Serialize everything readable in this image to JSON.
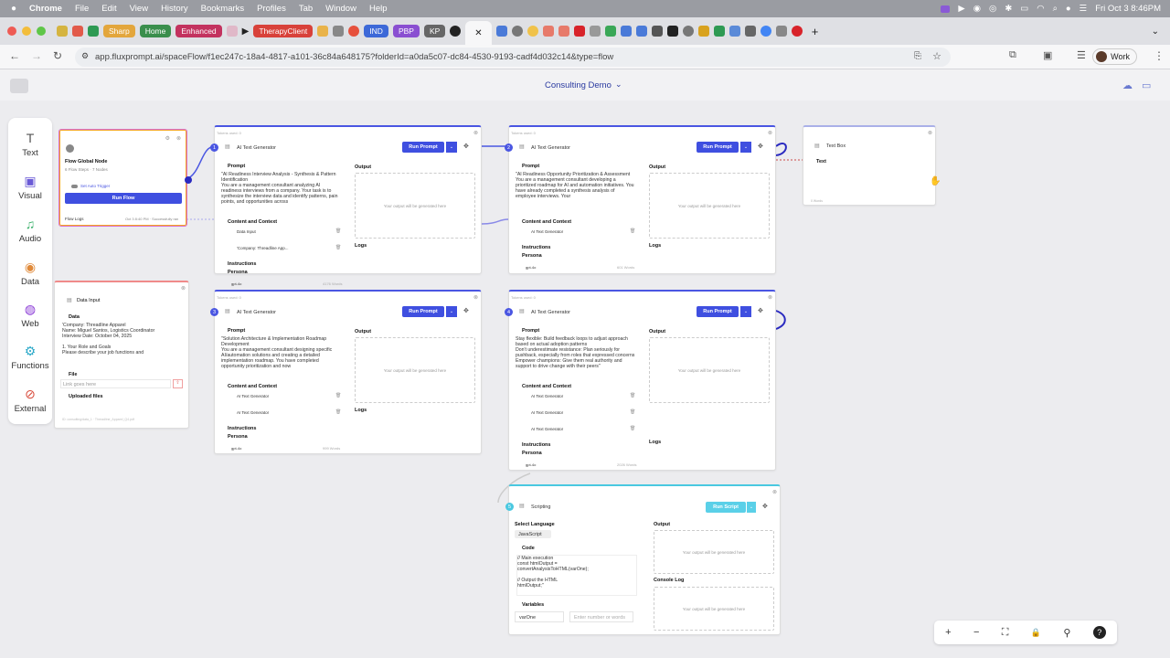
{
  "menubar": {
    "app": "Chrome",
    "items": [
      "File",
      "Edit",
      "View",
      "History",
      "Bookmarks",
      "Profiles",
      "Tab",
      "Window",
      "Help"
    ],
    "datetime": "Fri Oct 3  8:46PM"
  },
  "tabs": {
    "sharp": "Sharp",
    "home": "Home",
    "enhanced": "Enhanced",
    "therapy": "TherapyClient",
    "ind": "IND",
    "pbp": "PBP",
    "kp": "KP"
  },
  "address": {
    "url": "app.fluxprompt.ai/spaceFlow/f1ec247c-18a4-4817-a101-36c84a648175?folderId=a0da5c07-dc84-4530-9193-cadf4d032c14&type=flow",
    "profile": "Work"
  },
  "app": {
    "title": "Consulting Demo"
  },
  "sidebar": {
    "items": [
      {
        "label": "Text",
        "glyph": "T"
      },
      {
        "label": "Visual",
        "glyph": "▣"
      },
      {
        "label": "Audio",
        "glyph": "♫"
      },
      {
        "label": "Data",
        "glyph": "◉"
      },
      {
        "label": "Web",
        "glyph": "◍"
      },
      {
        "label": "Functions",
        "glyph": "⚙"
      },
      {
        "label": "External",
        "glyph": "⊘"
      }
    ]
  },
  "global": {
    "title": "Flow Global Node",
    "sub": "6 Flow Steps · 7 Nodes",
    "trigger": "Set Auto Trigger",
    "run": "Run Flow",
    "logs": "Flow Logs",
    "status": "Oct 3 8:40 PM · Successfully ran"
  },
  "datainput": {
    "title": "Data Input",
    "data_label": "Data",
    "data_text": "'Company: Threadline Apparel\n Name: Miguel Santos, Logistics Coordinator\nInterview Date: October 04, 2025\n\n1. Your Role and Goals\nPlease describe your job functions and",
    "file_label": "File",
    "file_placeholder": "Link goes here",
    "uploaded": "Uploaded files",
    "footer": "ID: consulting/data_1 · Threadline_Apparel_Q4.pdf"
  },
  "nodes": [
    {
      "num": "1",
      "tokens": "Tokens used: 0",
      "title": "AI Text Generator",
      "run": "Run Prompt",
      "prompt_label": "Prompt",
      "prompt": "\"AI Readiness Interview Analysis - Synthesis & Pattern Identification\nYou are a management consultant analyzing AI readiness interviews from a company. Your task is to synthesize the interview data and identify patterns, pain points, and opportunities across",
      "context": "Content and Context",
      "data_items": [
        "Data Input",
        "'Company: Threadline App..."
      ],
      "instructions": "Instructions",
      "persona": "Persona",
      "model": "gpt-4o",
      "words": "4176 Words",
      "output": "Output",
      "placeholder": "Your output will be generated here",
      "logs": "Logs"
    },
    {
      "num": "2",
      "tokens": "Tokens used: 0",
      "title": "AI Text Generator",
      "run": "Run Prompt",
      "prompt_label": "Prompt",
      "prompt": "\"AI Readiness Opportunity Prioritization & Assessment\nYou are a management consultant developing a prioritized roadmap for AI and automation initiatives. You have already completed a synthesis analysis of employee interviews. Your",
      "context": "Content and Context",
      "data_items": [
        "AI Text Generator"
      ],
      "instructions": "Instructions",
      "persona": "Persona",
      "model": "gpt-4o",
      "words": "601 Words",
      "output": "Output",
      "placeholder": "Your output will be generated here",
      "logs": "Logs"
    },
    {
      "num": "3",
      "tokens": "Tokens used: 0",
      "title": "AI Text Generator",
      "run": "Run Prompt",
      "prompt_label": "Prompt",
      "prompt": "\"Solution Architecture & Implementation Roadmap Development\nYou are a management consultant designing specific AI/automation solutions and creating a detailed implementation roadmap. You have completed opportunity prioritization and now",
      "context": "Content and Context",
      "data_items": [
        "AI Text Generator",
        "AI Text Generator"
      ],
      "instructions": "Instructions",
      "persona": "Persona",
      "model": "gpt-4o",
      "words": "999 Words",
      "output": "Output",
      "placeholder": "Your output will be generated here",
      "logs": "Logs"
    },
    {
      "num": "4",
      "tokens": "Tokens used: 0",
      "title": "AI Text Generator",
      "run": "Run Prompt",
      "prompt_label": "Prompt",
      "prompt": "Stay flexible: Build feedback loops to adjust approach based on actual adoption patterns\nDon't underestimate resistance: Plan seriously for pushback, especially from roles that expressed concerns\nEmpower champions: Give them real authority and support to drive change with their peers\"",
      "context": "Content and Context",
      "data_items": [
        "AI Text Generator",
        "AI Text Generator",
        "AI Text Generator"
      ],
      "instructions": "Instructions",
      "persona": "Persona",
      "model": "gpt-4o",
      "words": "2026 Words",
      "output": "Output",
      "placeholder": "Your output will be generated here",
      "logs": "Logs"
    }
  ],
  "textbox": {
    "title": "Text Box",
    "text": "Text",
    "words": "0 Words"
  },
  "scripting": {
    "num": "5",
    "title": "Scripting",
    "run": "Run Script",
    "lang_label": "Select Language",
    "lang": "JavaScript",
    "code_label": "Code",
    "code": "// Main execution\nconst htmlOutput =\nconvertAnalysisToHTML(varOne);\n\n// Output the HTML\nhtmlOutput;\"",
    "vars_label": "Variables",
    "var_name": "varOne",
    "var_placeholder": "Enter number or words",
    "output": "Output",
    "placeholder": "Your output will be generated here",
    "console": "Console Log"
  },
  "toolbar": {
    "zoom_in": "+",
    "zoom_out": "−",
    "fit": "⛶",
    "lock": "🔒",
    "link": "⚲",
    "help": "?"
  }
}
